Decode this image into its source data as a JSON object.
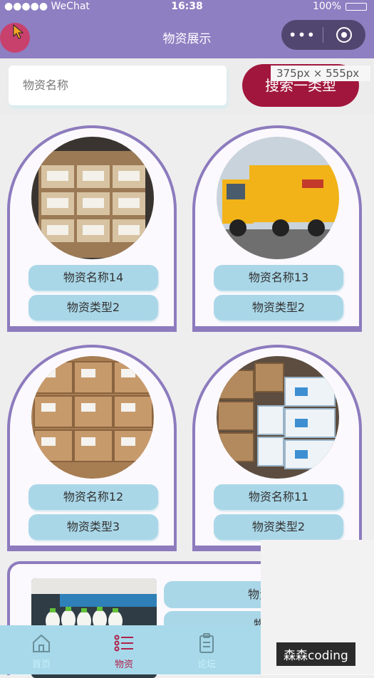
{
  "status_bar": {
    "carrier": "●●●●● WeChat",
    "time": "16:38",
    "battery": "100%"
  },
  "nav": {
    "title": "物资展示"
  },
  "search": {
    "placeholder": "物资名称",
    "button": "搜索一类型"
  },
  "size_tip": "375px × 555px",
  "cards": [
    {
      "name": "物资名称14",
      "type": "物资类型2"
    },
    {
      "name": "物资名称13",
      "type": "物资类型2"
    },
    {
      "name": "物资名称12",
      "type": "物资类型3"
    },
    {
      "name": "物资名称11",
      "type": "物资类型2"
    }
  ],
  "partial_card": {
    "name": "物资名称",
    "type": "物资类"
  },
  "tabs": [
    {
      "label": "首页",
      "icon": "home-icon",
      "color": "#c9eff7"
    },
    {
      "label": "物资",
      "icon": "list-icon",
      "color": "#b0224c"
    },
    {
      "label": "论坛",
      "icon": "clipboard-icon",
      "color": "#c9eff7"
    }
  ],
  "watermark": "森森coding",
  "colors": {
    "nav": "#8e7fc2",
    "accent": "#a1163c",
    "card_border": "#8d7bbe",
    "pill": "#a9d7e8",
    "tabbar": "#a7d9ea"
  }
}
